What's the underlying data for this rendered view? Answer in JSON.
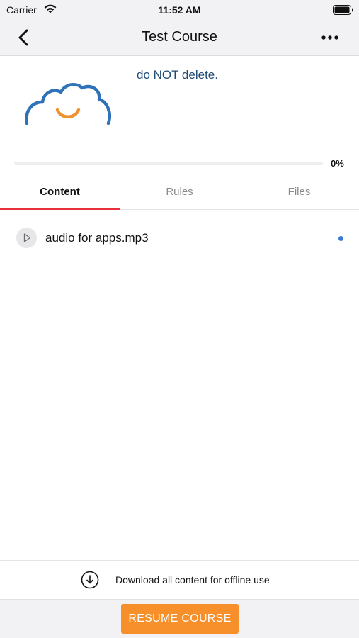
{
  "status_bar": {
    "carrier": "Carrier",
    "time": "11:52 AM"
  },
  "nav": {
    "title": "Test Course",
    "back_icon": "chevron-left-icon",
    "more_icon": "more-horizontal-icon"
  },
  "course": {
    "logo_icon": "cloud-smile-logo",
    "description": "do NOT delete.",
    "progress": {
      "value": 0,
      "label": "0%"
    }
  },
  "tabs": [
    {
      "label": "Content",
      "active": true
    },
    {
      "label": "Rules",
      "active": false
    },
    {
      "label": "Files",
      "active": false
    }
  ],
  "content_items": [
    {
      "title": "audio for apps.mp3",
      "icon": "play-icon",
      "unread": true
    }
  ],
  "download_bar": {
    "icon": "download-circle-icon",
    "label": "Download all content for offline use"
  },
  "actions": {
    "resume_label": "RESUME COURSE"
  },
  "colors": {
    "accent_red": "#e8313a",
    "resume_orange": "#f7902a",
    "logo_blue": "#2f72b8",
    "logo_orange": "#f0902f",
    "description_blue": "#1f4a75",
    "unread_dot_blue": "#3b7bd8"
  }
}
